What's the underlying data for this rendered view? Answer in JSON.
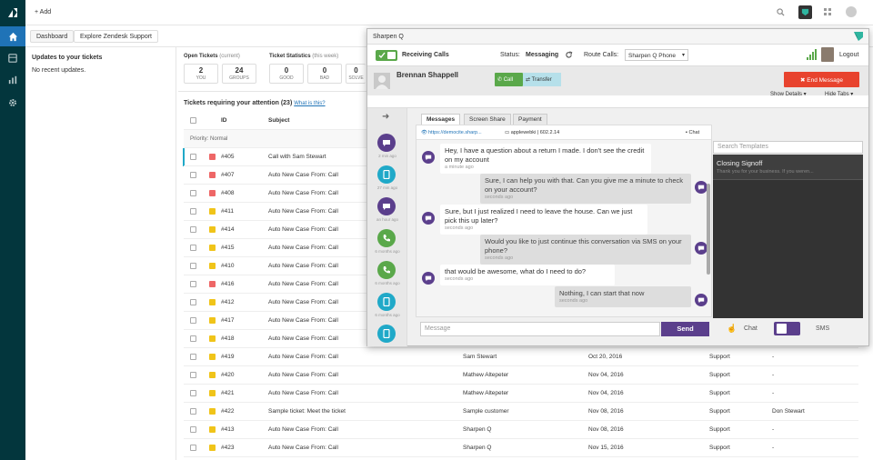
{
  "topbar": {
    "add_label": "+ Add"
  },
  "subbar": {
    "tabs": [
      "Dashboard",
      "Explore Zendesk Support"
    ]
  },
  "updates": {
    "title": "Updates to your tickets",
    "empty": "No recent updates."
  },
  "open_tickets": {
    "title": "Open Tickets",
    "title_sub": "(current)",
    "you": {
      "n": "2",
      "l": "YOU"
    },
    "groups": {
      "n": "24",
      "l": "GROUPS"
    }
  },
  "ticket_stats": {
    "title": "Ticket Statistics",
    "title_sub": "(this week)",
    "good": {
      "n": "0",
      "l": "GOOD"
    },
    "bad": {
      "n": "0",
      "l": "BAD"
    },
    "solved": {
      "n": "0",
      "l": "SOLVE"
    }
  },
  "tickets": {
    "title": "Tickets requiring your attention (23)",
    "whats_this": "What is this?",
    "col_id": "ID",
    "col_subject": "Subject",
    "priority_group": "Priority: Normal",
    "rows": [
      {
        "id": "#405",
        "subject": "Call with Sam Stewart",
        "requester": "",
        "date": "",
        "group": "",
        "assignee": "",
        "pri": "o"
      },
      {
        "id": "#407",
        "subject": "Auto New Case From: Call",
        "requester": "",
        "date": "",
        "group": "",
        "assignee": "",
        "pri": "o"
      },
      {
        "id": "#408",
        "subject": "Auto New Case From: Call",
        "requester": "",
        "date": "",
        "group": "",
        "assignee": "",
        "pri": "o"
      },
      {
        "id": "#411",
        "subject": "Auto New Case From: Call",
        "requester": "",
        "date": "",
        "group": "",
        "assignee": "",
        "pri": "n"
      },
      {
        "id": "#414",
        "subject": "Auto New Case From: Call",
        "requester": "",
        "date": "",
        "group": "",
        "assignee": "",
        "pri": "n"
      },
      {
        "id": "#415",
        "subject": "Auto New Case From: Call",
        "requester": "",
        "date": "",
        "group": "",
        "assignee": "",
        "pri": "n"
      },
      {
        "id": "#410",
        "subject": "Auto New Case From: Call",
        "requester": "",
        "date": "",
        "group": "",
        "assignee": "",
        "pri": "n"
      },
      {
        "id": "#416",
        "subject": "Auto New Case From: Call",
        "requester": "",
        "date": "",
        "group": "",
        "assignee": "",
        "pri": "o"
      },
      {
        "id": "#412",
        "subject": "Auto New Case From: Call",
        "requester": "",
        "date": "",
        "group": "",
        "assignee": "",
        "pri": "n"
      },
      {
        "id": "#417",
        "subject": "Auto New Case From: Call",
        "requester": "",
        "date": "",
        "group": "",
        "assignee": "",
        "pri": "n"
      },
      {
        "id": "#418",
        "subject": "Auto New Case From: Call",
        "requester": "",
        "date": "",
        "group": "",
        "assignee": "",
        "pri": "n"
      },
      {
        "id": "#419",
        "subject": "Auto New Case From: Call",
        "requester": "Sam Stewart",
        "date": "Oct 20, 2016",
        "group": "Support",
        "assignee": "-",
        "pri": "n"
      },
      {
        "id": "#420",
        "subject": "Auto New Case From: Call",
        "requester": "Mathew Altepeter",
        "date": "Nov 04, 2016",
        "group": "Support",
        "assignee": "-",
        "pri": "n"
      },
      {
        "id": "#421",
        "subject": "Auto New Case From: Call",
        "requester": "Mathew Altepeter",
        "date": "Nov 04, 2016",
        "group": "Support",
        "assignee": "-",
        "pri": "n"
      },
      {
        "id": "#422",
        "subject": "Sample ticket: Meet the ticket",
        "requester": "Sample customer",
        "date": "Nov 08, 2016",
        "group": "Support",
        "assignee": "Don Stewart",
        "pri": "n"
      },
      {
        "id": "#413",
        "subject": "Auto New Case From: Call",
        "requester": "Sharpen Q",
        "date": "Nov 08, 2016",
        "group": "Support",
        "assignee": "-",
        "pri": "n"
      },
      {
        "id": "#423",
        "subject": "Auto New Case From: Call",
        "requester": "Sharpen Q",
        "date": "Nov 15, 2016",
        "group": "Support",
        "assignee": "-",
        "pri": "n"
      }
    ]
  },
  "panel": {
    "title": "Sharpen Q",
    "receiving": "Receiving Calls",
    "status_label": "Status:",
    "status_value": "Messaging",
    "route_label": "Route Calls:",
    "route_value": "Sharpen Q Phone",
    "logout": "Logout",
    "caller_name": "Brennan Shappell",
    "call_btn": "Call",
    "transfer_btn": "Transfer",
    "end_btn": "End Message",
    "show_details": "Show Details",
    "hide_tabs": "Hide Tabs",
    "tabs": [
      "Messages",
      "Screen Share",
      "Payment"
    ],
    "url": "https://democite.sharp...",
    "device": "applewebki | 602.2.14",
    "chat_label": "Chat",
    "timeline_times": [
      "2 min ago",
      "27 min ago",
      "an hour ago",
      "6 months ago",
      "6 months ago",
      "6 months ago"
    ],
    "messages": [
      {
        "dir": "in",
        "text": "Hey, I have a question about a return I made. I don't see the credit on my account",
        "time": "a minute ago"
      },
      {
        "dir": "out",
        "text": "Sure, I can help you with that. Can you give me a minute to check on your account?",
        "time": "seconds ago"
      },
      {
        "dir": "in",
        "text": "Sure, but I just realized I need to leave the house. Can we just pick this up later?",
        "time": "seconds ago"
      },
      {
        "dir": "out",
        "text": "Would you like to just continue this conversation via SMS on your phone?",
        "time": "seconds ago"
      },
      {
        "dir": "in",
        "text": "that would be awesome, what do I need to do?",
        "time": "seconds ago"
      },
      {
        "dir": "out",
        "text": "Nothing, I can start that now",
        "time": "seconds ago"
      }
    ],
    "message_placeholder": "Message",
    "send": "Send",
    "toggle_chat": "Chat",
    "toggle_sms": "SMS",
    "template_search_placeholder": "Search Templates",
    "template": {
      "title": "Closing Signoff",
      "preview": "Thank you for your business. If you weren..."
    }
  },
  "colors": {
    "rail": "#03363d",
    "green": "#5aa84a",
    "purple": "#5b3f8c",
    "red": "#e8432e",
    "teal": "#20a9c8"
  }
}
